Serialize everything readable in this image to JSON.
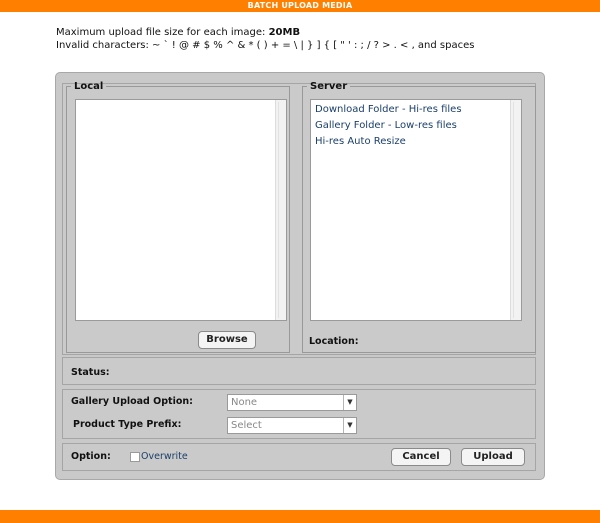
{
  "header": {
    "title": "BATCH UPLOAD MEDIA"
  },
  "info": {
    "max_size_prefix": "Maximum upload file size for each image: ",
    "max_size_value": "20MB",
    "invalid_chars": "Invalid characters: ~ ` ! @ # $ % ^ & * ( ) + = \\ | } ] { [ \" ' : ; / ? > . < , and spaces"
  },
  "local": {
    "legend": "Local",
    "browse_label": "Browse"
  },
  "server": {
    "legend": "Server",
    "items": [
      "Download Folder - Hi-res files",
      "Gallery Folder - Low-res files",
      "Hi-res Auto Resize"
    ],
    "location_label": "Location:"
  },
  "status": {
    "label": "Status:"
  },
  "options": {
    "gallery_label": "Gallery Upload Option:",
    "gallery_value": "None",
    "prefix_label": "Product Type Prefix:",
    "prefix_value": "Select"
  },
  "footer": {
    "option_label": "Option:",
    "overwrite_label": "Overwrite",
    "overwrite_checked": false,
    "cancel_label": "Cancel",
    "upload_label": "Upload"
  },
  "icons": {
    "dropdown": "chevron-down-icon"
  },
  "colors": {
    "accent": "#ff8000",
    "panel": "#c9c9c9",
    "link": "#1a3f6b"
  }
}
